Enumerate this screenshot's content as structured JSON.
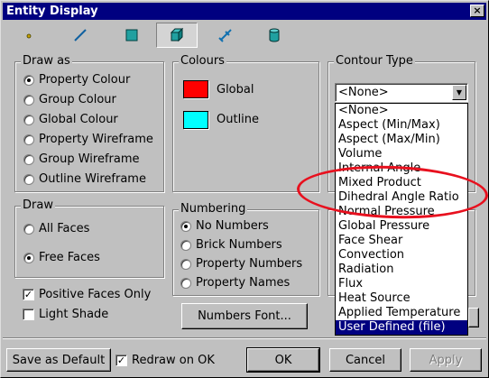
{
  "window": {
    "title": "Entity Display",
    "close_glyph": "×"
  },
  "toolbar": {
    "tools": [
      {
        "name": "point-icon"
      },
      {
        "name": "line-icon"
      },
      {
        "name": "plate-icon"
      },
      {
        "name": "brick-icon",
        "active": true
      },
      {
        "name": "link-icon"
      },
      {
        "name": "cylinder-icon"
      }
    ]
  },
  "draw_as": {
    "label": "Draw as",
    "options": [
      "Property Colour",
      "Group Colour",
      "Global Colour",
      "Property Wireframe",
      "Group Wireframe",
      "Outline Wireframe"
    ],
    "selected": "Property Colour"
  },
  "colours": {
    "label": "Colours",
    "global_label": "Global",
    "global_color": "#ff0000",
    "outline_label": "Outline",
    "outline_color": "#00ffff"
  },
  "contour_type": {
    "label": "Contour Type",
    "value": "<None>",
    "options": [
      "<None>",
      "Aspect (Min/Max)",
      "Aspect (Max/Min)",
      "Volume",
      "Internal Angle",
      "Mixed Product",
      "Dihedral Angle Ratio",
      "Normal Pressure",
      "Global Pressure",
      "Face Shear",
      "Convection",
      "Radiation",
      "Flux",
      "Heat Source",
      "Applied Temperature",
      "User Defined (file)"
    ],
    "highlighted": "User Defined (file)"
  },
  "draw": {
    "label": "Draw",
    "options": [
      "All Faces",
      "Free Faces"
    ],
    "selected": "Free Faces"
  },
  "numbering": {
    "label": "Numbering",
    "options": [
      "No Numbers",
      "Brick Numbers",
      "Property Numbers",
      "Property Names"
    ],
    "selected": "No Numbers"
  },
  "checks": {
    "positive_faces": {
      "label": "Positive Faces Only",
      "checked": true
    },
    "light_shade": {
      "label": "Light Shade",
      "checked": false
    },
    "redraw_on_ok": {
      "label": "Redraw on OK",
      "checked": true
    }
  },
  "buttons": {
    "numbers_font": "Numbers Font...",
    "save_default": "Save as Default",
    "ok": "OK",
    "cancel": "Cancel",
    "apply": "Apply"
  },
  "annotation": {
    "color": "#e8101e"
  }
}
